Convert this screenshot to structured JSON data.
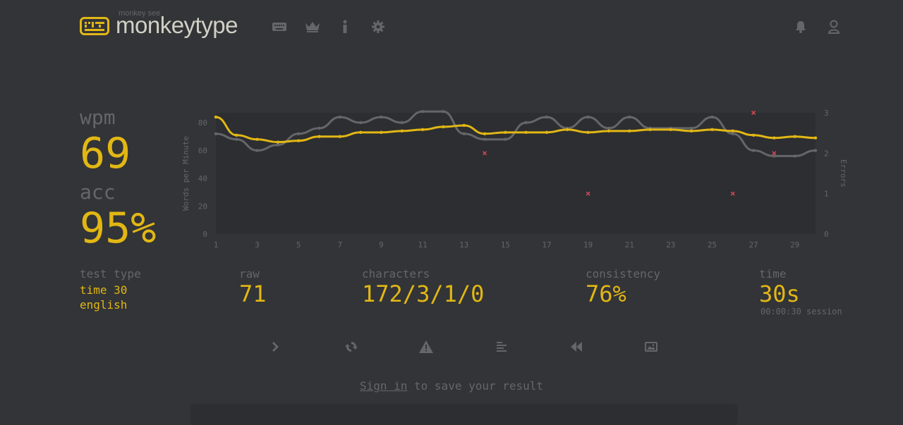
{
  "header": {
    "brand_top": "monkey see",
    "brand": "monkeytype",
    "nav": [
      "keyboard-icon",
      "crown-icon",
      "info-icon",
      "gear-icon"
    ],
    "right": [
      "bell-icon",
      "user-icon"
    ]
  },
  "stats": {
    "wpm_label": "wpm",
    "wpm_value": "69",
    "acc_label": "acc",
    "acc_value": "95%",
    "test_type_label": "test type",
    "test_type_line1": "time 30",
    "test_type_line2": "english",
    "raw_label": "raw",
    "raw_value": "71",
    "characters_label": "characters",
    "characters_value": "172/3/1/0",
    "consistency_label": "consistency",
    "consistency_value": "76%",
    "time_label": "time",
    "time_value": "30s",
    "session": "00:00:30 session"
  },
  "chart_data": {
    "type": "line",
    "ylabel": "Words per Minute",
    "y2label": "Errors",
    "ylim": [
      0,
      80
    ],
    "y2lim": [
      0,
      3
    ],
    "yticks": [
      "0",
      "20",
      "40",
      "60",
      "80"
    ],
    "y2ticks": [
      "0",
      "1",
      "2",
      "3"
    ],
    "xticks": [
      "1",
      "3",
      "5",
      "7",
      "9",
      "11",
      "13",
      "15",
      "17",
      "19",
      "21",
      "23",
      "25",
      "27",
      "29"
    ],
    "x": [
      1,
      2,
      3,
      4,
      5,
      6,
      7,
      8,
      9,
      10,
      11,
      12,
      13,
      14,
      15,
      16,
      17,
      18,
      19,
      20,
      21,
      22,
      23,
      24,
      25,
      26,
      27,
      28,
      29,
      30
    ],
    "series": [
      {
        "id": "raw",
        "color": "#646669",
        "values": [
          72,
          68,
          60,
          64,
          72,
          76,
          84,
          80,
          84,
          80,
          88,
          88,
          72,
          68,
          68,
          80,
          84,
          76,
          84,
          76,
          84,
          76,
          76,
          76,
          84,
          72,
          60,
          56,
          56,
          60
        ]
      },
      {
        "id": "wpm",
        "color": "#e2b714",
        "values": [
          84,
          71,
          68,
          66,
          67,
          70,
          70,
          73,
          73,
          74,
          75,
          77,
          78,
          72,
          73,
          73,
          73,
          75,
          73,
          74,
          74,
          75,
          75,
          74,
          75,
          74,
          71,
          69,
          70,
          69
        ]
      }
    ],
    "errors": [
      {
        "x": 14,
        "y": 2
      },
      {
        "x": 19,
        "y": 1
      },
      {
        "x": 26,
        "y": 1
      },
      {
        "x": 27,
        "y": 3
      },
      {
        "x": 28,
        "y": 2
      }
    ],
    "grid": false
  },
  "actions": [
    "next-test-icon",
    "restart-icon",
    "report-icon",
    "words-history-icon",
    "replay-icon",
    "screenshot-icon"
  ],
  "signin": {
    "link": "Sign in",
    "rest": " to save your result"
  }
}
